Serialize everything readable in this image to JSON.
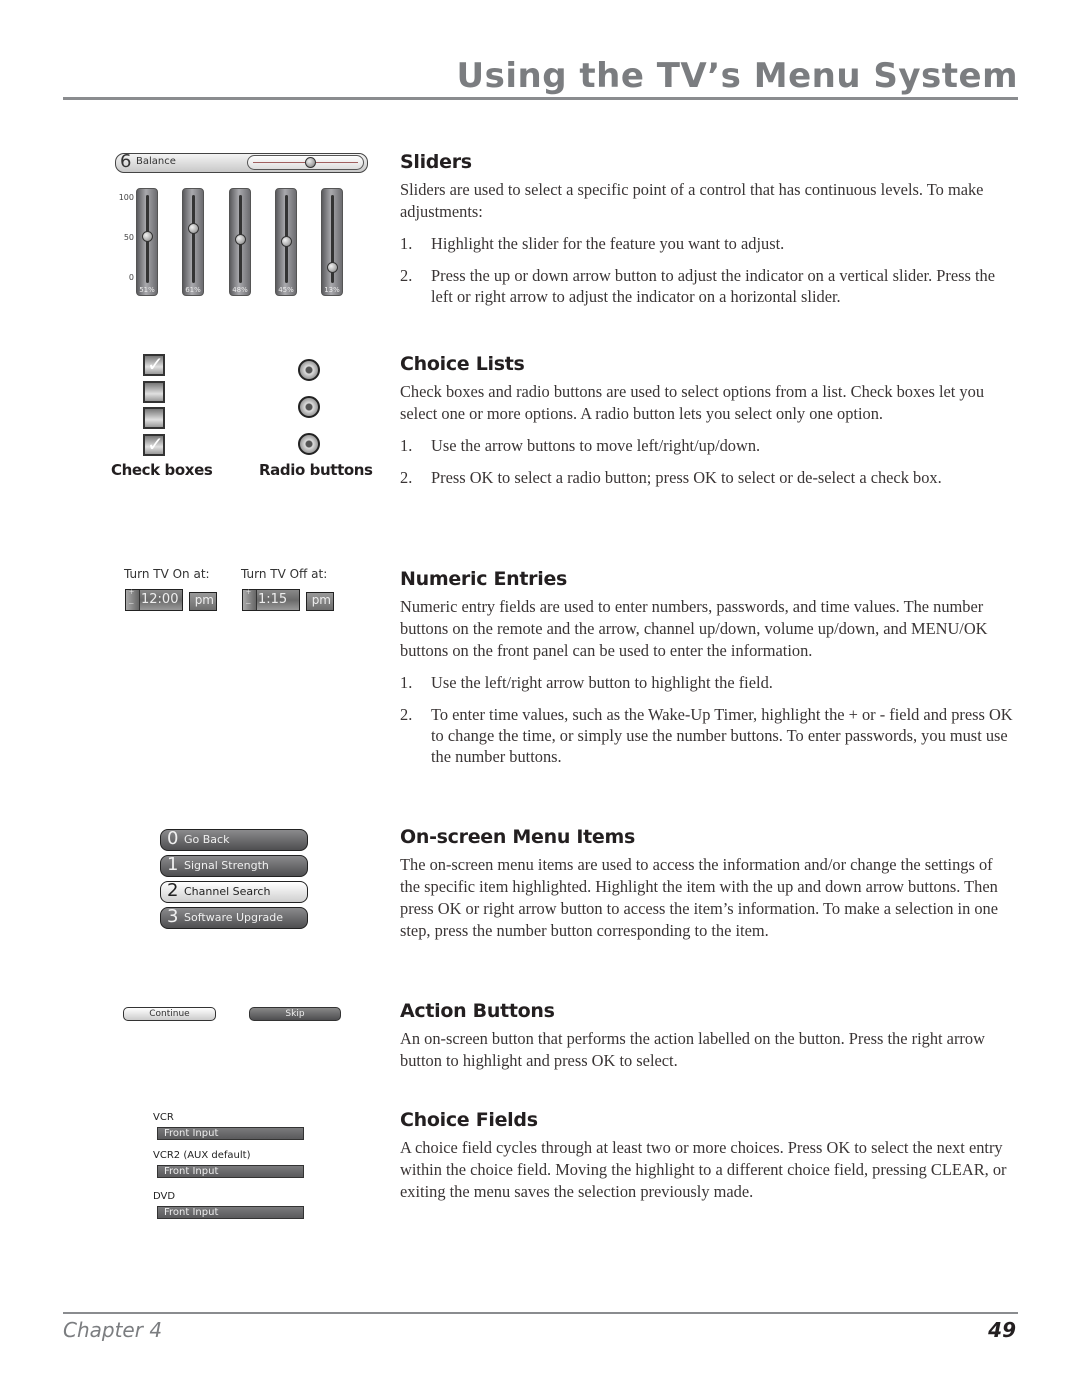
{
  "header": {
    "title": "Using the TV’s Menu System"
  },
  "footer": {
    "chapter": "Chapter 4",
    "page_number": "49"
  },
  "widgets": {
    "balance": {
      "number": "6",
      "label": "Balance",
      "value_fraction": 0.55
    },
    "vertical_sliders": {
      "scale": [
        "100",
        "50",
        "0"
      ],
      "items": [
        {
          "label": "51%",
          "value": 51
        },
        {
          "label": "61%",
          "value": 61
        },
        {
          "label": "48%",
          "value": 48
        },
        {
          "label": "45%",
          "value": 45
        },
        {
          "label": "13%",
          "value": 13
        }
      ]
    },
    "checkboxes": [
      {
        "checked": true
      },
      {
        "checked": false
      },
      {
        "checked": false
      },
      {
        "checked": true
      }
    ],
    "check_mark": "✓",
    "radio_count": 3,
    "checkboxes_label": "Check boxes",
    "radio_label": "Radio buttons",
    "timers": [
      {
        "label": "Turn TV On at:",
        "time": "12:00",
        "ampm": "pm"
      },
      {
        "label": "Turn TV Off at:",
        "time": "1:15",
        "ampm": "pm"
      }
    ],
    "menu_items": [
      {
        "number": "0",
        "label": "Go Back",
        "selected": false
      },
      {
        "number": "1",
        "label": "Signal Strength",
        "selected": false
      },
      {
        "number": "2",
        "label": "Channel Search",
        "selected": true
      },
      {
        "number": "3",
        "label": "Software Upgrade",
        "selected": false
      }
    ],
    "action_buttons": {
      "continue": "Continue",
      "skip": "Skip"
    },
    "choice_fields": [
      {
        "label": "VCR",
        "value": "Front Input"
      },
      {
        "label": "VCR2 (AUX default)",
        "value": "Front Input"
      },
      {
        "label": "DVD",
        "value": "Front Input"
      }
    ]
  },
  "sections": {
    "sliders": {
      "heading": "Sliders",
      "intro": "Sliders are used to select a specific point of a control that has continuous levels. To make adjustments:",
      "steps": [
        "Highlight the slider for the feature you want to adjust.",
        "Press the up or down arrow button to adjust the indicator on a vertical slider. Press the left or right arrow to adjust the indicator on a horizontal slider."
      ]
    },
    "choice_lists": {
      "heading": "Choice Lists",
      "intro": "Check boxes and radio buttons are used to select options from a list. Check boxes let you select one or more options. A radio button lets you select only one option.",
      "steps": [
        "Use the arrow buttons to move left/right/up/down.",
        "Press OK to select a radio button; press OK to select or de-select a check box."
      ]
    },
    "numeric_entries": {
      "heading": "Numeric Entries",
      "intro": "Numeric entry fields are used to enter numbers, passwords, and time values. The number buttons on the remote and the arrow, channel up/down, volume up/down, and MENU/OK buttons on the front panel can be used to enter the information.",
      "steps": [
        "Use the left/right arrow button to highlight the field.",
        "To enter time values, such as the Wake-Up Timer, highlight the + or - field and press OK to change the time, or simply use the number buttons. To enter passwords, you must use the number buttons."
      ]
    },
    "menu_items": {
      "heading": "On-screen Menu Items",
      "intro": "The on-screen menu items are used to access the information and/or change the settings of the specific item highlighted. Highlight the item with the up and down arrow buttons. Then press OK or right arrow button to access the item’s information. To make a selection in one step, press the number button corresponding to the item."
    },
    "action_buttons": {
      "heading": "Action Buttons",
      "intro": "An on-screen button that performs the action labelled on the button. Press the right arrow button to highlight and press OK to select."
    },
    "choice_fields": {
      "heading": "Choice Fields",
      "intro": "A choice field cycles through at least two or more choices. Press OK to select the next entry within the choice field. Moving the highlight to a different choice field, pressing CLEAR, or exiting the menu saves the selection previously made."
    }
  },
  "step_numbers": [
    "1.",
    "2."
  ]
}
